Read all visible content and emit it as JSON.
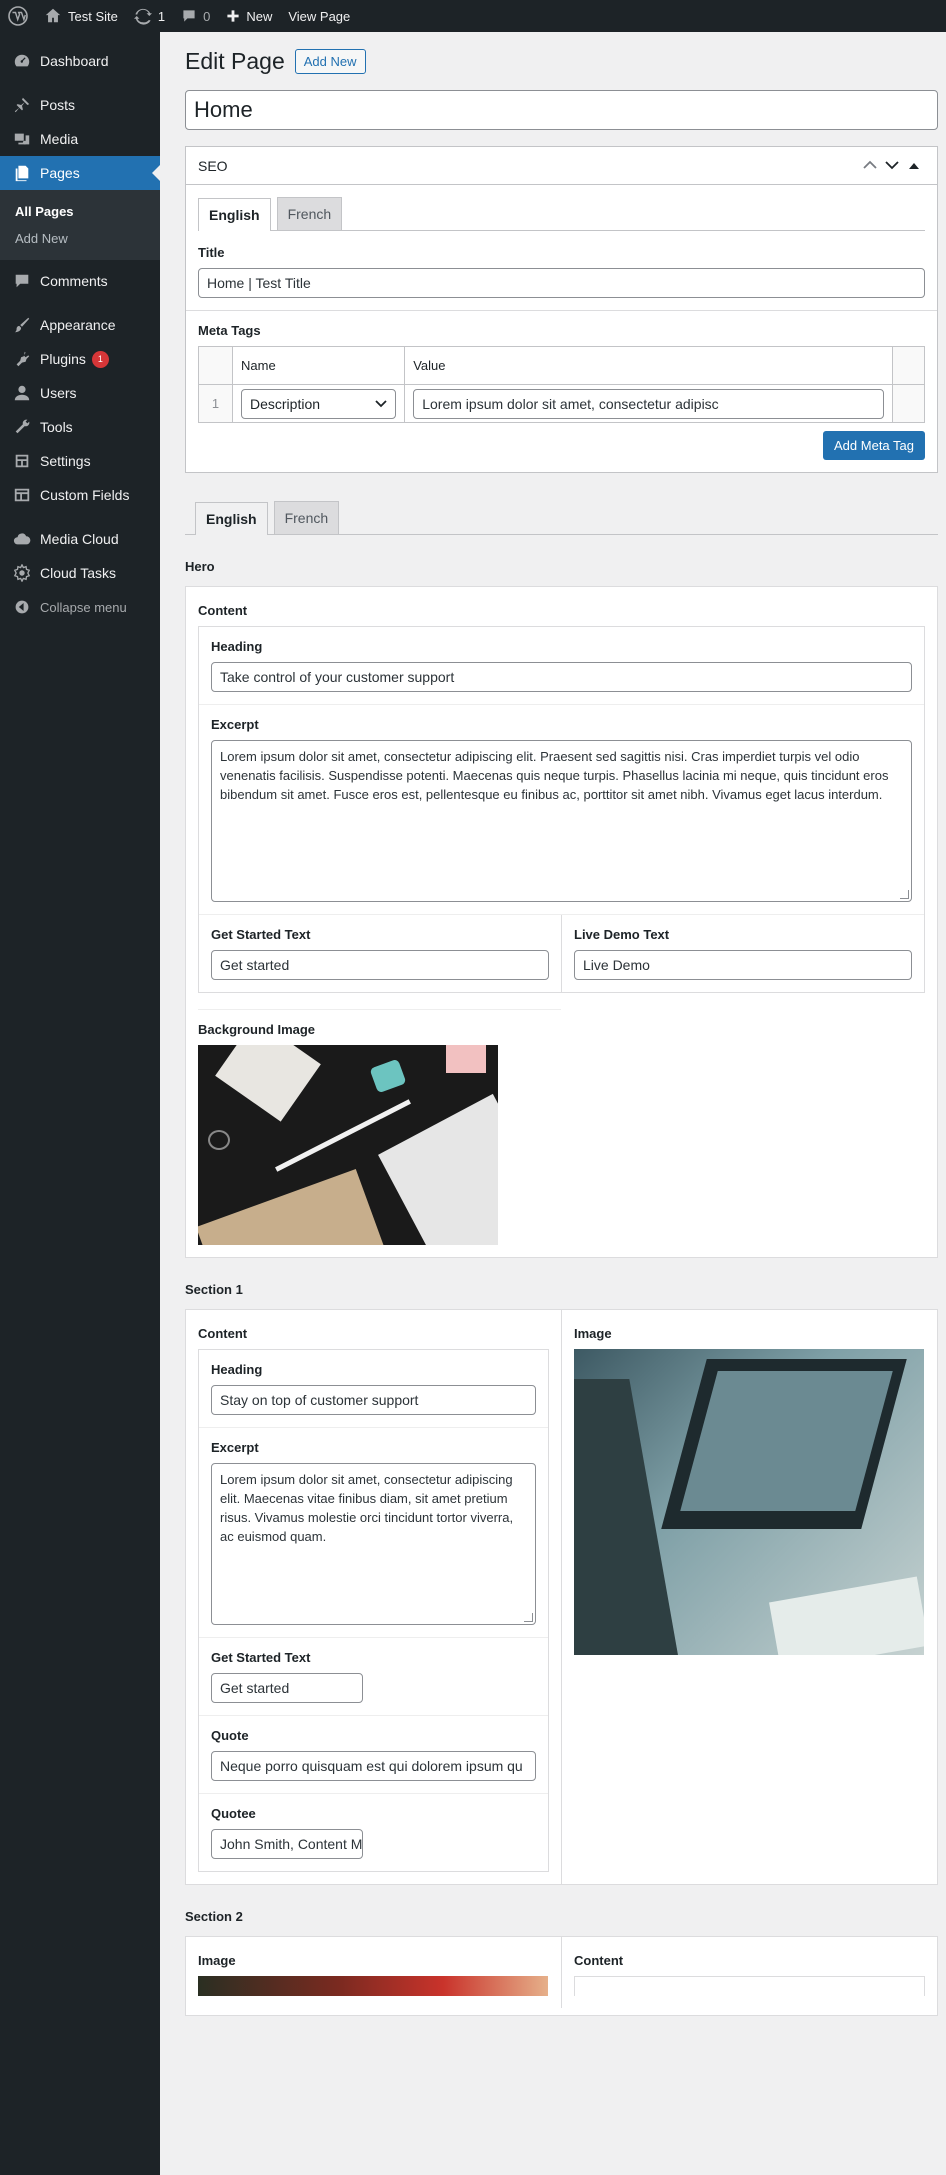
{
  "adminbar": {
    "site_name": "Test Site",
    "updates_count": "1",
    "comments_count": "0",
    "new_label": "New",
    "view_page_label": "View Page"
  },
  "sidebar": {
    "items": [
      {
        "label": "Dashboard",
        "icon": "dashboard-icon"
      },
      {
        "label": "Posts",
        "icon": "pin-icon"
      },
      {
        "label": "Media",
        "icon": "media-icon"
      },
      {
        "label": "Pages",
        "icon": "pages-icon"
      },
      {
        "label": "Comments",
        "icon": "comment-icon"
      },
      {
        "label": "Appearance",
        "icon": "brush-icon"
      },
      {
        "label": "Plugins",
        "icon": "plugin-icon",
        "badge": "1"
      },
      {
        "label": "Users",
        "icon": "user-icon"
      },
      {
        "label": "Tools",
        "icon": "wrench-icon"
      },
      {
        "label": "Settings",
        "icon": "settings-icon"
      },
      {
        "label": "Custom Fields",
        "icon": "table-icon"
      },
      {
        "label": "Media Cloud",
        "icon": "cloud-icon"
      },
      {
        "label": "Cloud Tasks",
        "icon": "cloud-tasks-icon"
      },
      {
        "label": "Collapse menu",
        "icon": "collapse-icon"
      }
    ],
    "submenu": [
      "All Pages",
      "Add New"
    ]
  },
  "page": {
    "heading": "Edit Page",
    "add_new": "Add New",
    "title_value": "Home"
  },
  "seo": {
    "box_title": "SEO",
    "tabs": [
      "English",
      "French"
    ],
    "title_label": "Title",
    "title_value": "Home | Test Title",
    "meta_label": "Meta Tags",
    "col_name": "Name",
    "col_value": "Value",
    "row_num": "1",
    "row_name": "Description",
    "row_value": "Lorem ipsum dolor sit amet, consectetur adipisc",
    "add_meta": "Add Meta Tag"
  },
  "lang_tabs": [
    "English",
    "French"
  ],
  "hero": {
    "title": "Hero",
    "content_label": "Content",
    "heading_label": "Heading",
    "heading_value": "Take control of your customer support",
    "excerpt_label": "Excerpt",
    "excerpt_value": "Lorem ipsum dolor sit amet, consectetur adipiscing elit. Praesent sed sagittis nisi. Cras imperdiet turpis vel odio venenatis facilisis. Suspendisse potenti. Maecenas quis neque turpis. Phasellus lacinia mi neque, quis tincidunt eros bibendum sit amet. Fusce eros est, pellentesque eu finibus ac, porttitor sit amet nibh. Vivamus eget lacus interdum.",
    "get_started_label": "Get Started Text",
    "get_started_value": "Get started",
    "live_demo_label": "Live Demo Text",
    "live_demo_value": "Live Demo",
    "bg_label": "Background Image"
  },
  "section1": {
    "title": "Section 1",
    "content_label": "Content",
    "image_label": "Image",
    "heading_label": "Heading",
    "heading_value": "Stay on top of customer support",
    "excerpt_label": "Excerpt",
    "excerpt_value": "Lorem ipsum dolor sit amet, consectetur adipiscing elit. Maecenas vitae finibus diam, sit amet pretium risus. Vivamus molestie orci tincidunt tortor viverra, ac euismod quam.",
    "get_started_label": "Get Started Text",
    "get_started_value": "Get started",
    "quote_label": "Quote",
    "quote_value": "Neque porro quisquam est qui dolorem ipsum qu",
    "quotee_label": "Quotee",
    "quotee_value": "John Smith, Content M"
  },
  "section2": {
    "title": "Section 2",
    "image_label": "Image",
    "content_label": "Content"
  }
}
